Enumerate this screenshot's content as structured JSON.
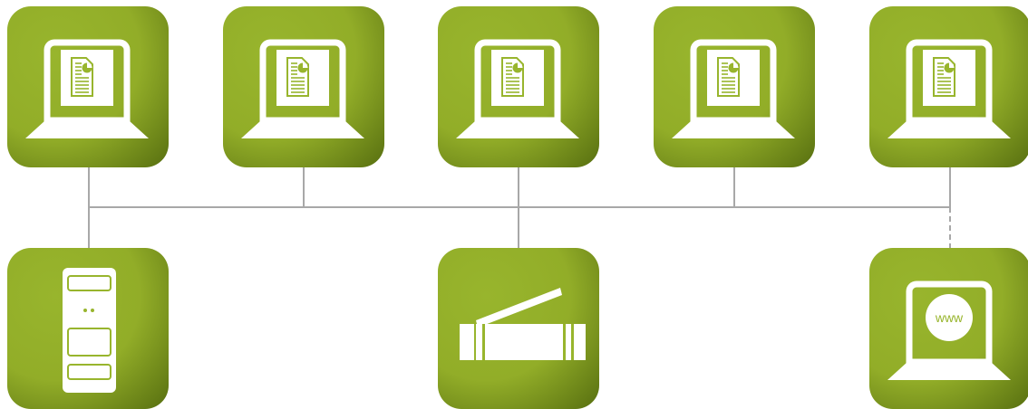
{
  "colors": {
    "tile_light": "#98b52d",
    "tile_dark": "#5c7412",
    "icon": "#ffffff",
    "wire": "#a8a8a8"
  },
  "nodes": {
    "workstations": [
      {
        "icon": "laptop-document-icon"
      },
      {
        "icon": "laptop-document-icon"
      },
      {
        "icon": "laptop-document-icon"
      },
      {
        "icon": "laptop-document-icon"
      },
      {
        "icon": "laptop-document-icon"
      }
    ],
    "server": {
      "icon": "server-tower-icon"
    },
    "scanner": {
      "icon": "flatbed-scanner-icon"
    },
    "web_client": {
      "icon": "laptop-www-icon",
      "label": "www"
    }
  },
  "links": {
    "internet_link_style": "dashed"
  }
}
